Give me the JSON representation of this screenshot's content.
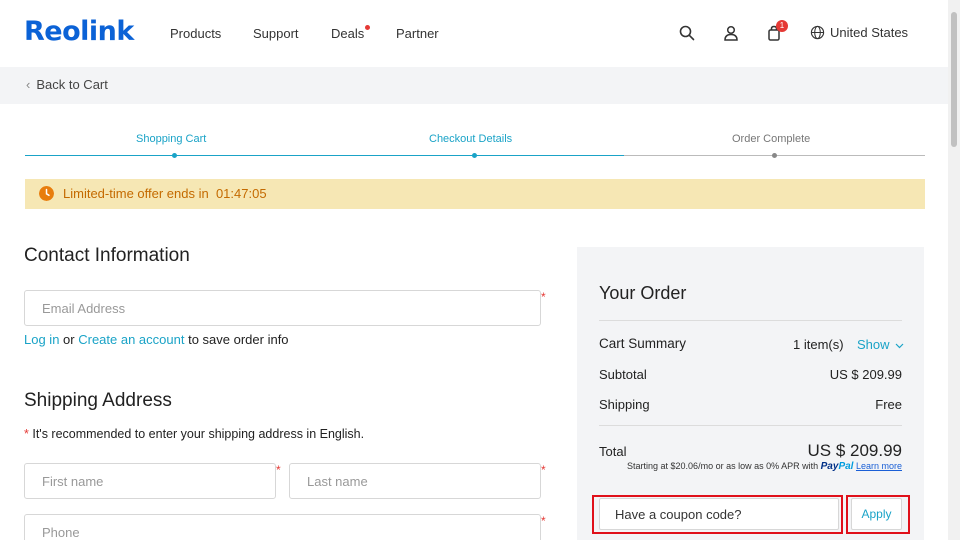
{
  "header": {
    "logo": "Reolink",
    "nav": [
      "Products",
      "Support",
      "Deals",
      "Partner"
    ],
    "cart_count": "1",
    "country": "United States",
    "icons": [
      "search-icon",
      "account-icon",
      "cart-icon",
      "globe-icon"
    ]
  },
  "back": {
    "label": "Back to Cart"
  },
  "steps": [
    {
      "label": "Shopping Cart",
      "state": "done"
    },
    {
      "label": "Checkout Details",
      "state": "active"
    },
    {
      "label": "Order Complete",
      "state": "pending"
    }
  ],
  "offer": {
    "label": "Limited-time offer ends in",
    "timer": "01:47:05"
  },
  "contact": {
    "title": "Contact Information",
    "email_placeholder": "Email Address",
    "login": "Log in",
    "or": "or",
    "create": "Create an account",
    "suffix": "to save order info"
  },
  "shipping": {
    "title": "Shipping Address",
    "note_star": "*",
    "note": "It's recommended to enter your shipping address in English.",
    "first_name": "First name",
    "last_name": "Last name",
    "phone": "Phone"
  },
  "order": {
    "title": "Your Order",
    "cart_summary": "Cart Summary",
    "items": "1 item(s)",
    "show": "Show",
    "subtotal_label": "Subtotal",
    "subtotal": "US $ 209.99",
    "shipping_label": "Shipping",
    "shipping": "Free",
    "total_label": "Total",
    "total": "US $ 209.99",
    "paypal_note": "Starting at $20.06/mo or as low as 0% APR with",
    "paypal_pay": "Pay",
    "paypal_pal": "Pal",
    "learn_more": "Learn more",
    "coupon_placeholder": "Have a coupon code?",
    "apply": "Apply"
  },
  "colors": {
    "brand": "#0b62d6",
    "accent": "#1aa3c7",
    "offer_bg": "#f6e7b4",
    "offer_text": "#c46a00",
    "highlight": "#e0101a"
  }
}
